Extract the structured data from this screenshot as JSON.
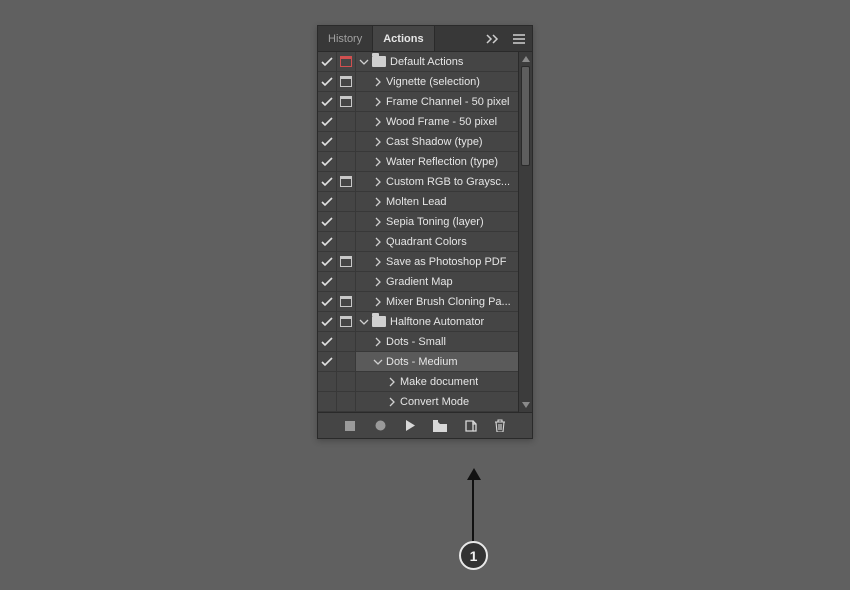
{
  "tabs": {
    "history": "History",
    "actions": "Actions",
    "active": "actions"
  },
  "list": [
    {
      "check": true,
      "dlg": "red",
      "depth": 0,
      "kind": "folder-open",
      "label": "Default Actions"
    },
    {
      "check": true,
      "dlg": "on",
      "depth": 1,
      "kind": "action-closed",
      "label": "Vignette (selection)"
    },
    {
      "check": true,
      "dlg": "on",
      "depth": 1,
      "kind": "action-closed",
      "label": "Frame Channel - 50 pixel"
    },
    {
      "check": true,
      "dlg": "off",
      "depth": 1,
      "kind": "action-closed",
      "label": "Wood Frame - 50 pixel"
    },
    {
      "check": true,
      "dlg": "off",
      "depth": 1,
      "kind": "action-closed",
      "label": "Cast Shadow (type)"
    },
    {
      "check": true,
      "dlg": "off",
      "depth": 1,
      "kind": "action-closed",
      "label": "Water Reflection (type)"
    },
    {
      "check": true,
      "dlg": "on",
      "depth": 1,
      "kind": "action-closed",
      "label": "Custom RGB to Graysc..."
    },
    {
      "check": true,
      "dlg": "off",
      "depth": 1,
      "kind": "action-closed",
      "label": "Molten Lead"
    },
    {
      "check": true,
      "dlg": "off",
      "depth": 1,
      "kind": "action-closed",
      "label": "Sepia Toning (layer)"
    },
    {
      "check": true,
      "dlg": "off",
      "depth": 1,
      "kind": "action-closed",
      "label": "Quadrant Colors"
    },
    {
      "check": true,
      "dlg": "on",
      "depth": 1,
      "kind": "action-closed",
      "label": "Save as Photoshop PDF"
    },
    {
      "check": true,
      "dlg": "off",
      "depth": 1,
      "kind": "action-closed",
      "label": "Gradient Map"
    },
    {
      "check": true,
      "dlg": "on",
      "depth": 1,
      "kind": "action-closed",
      "label": "Mixer Brush Cloning Pa..."
    },
    {
      "check": true,
      "dlg": "on",
      "depth": 0,
      "kind": "folder-open",
      "label": "Halftone Automator"
    },
    {
      "check": true,
      "dlg": "off",
      "depth": 1,
      "kind": "action-closed",
      "label": "Dots - Small"
    },
    {
      "check": true,
      "dlg": "off",
      "depth": 1,
      "kind": "action-open",
      "label": "Dots - Medium",
      "selected": true
    },
    {
      "check": false,
      "dlg": "off",
      "depth": 2,
      "kind": "step-closed",
      "label": "Make document"
    },
    {
      "check": false,
      "dlg": "off",
      "depth": 2,
      "kind": "step-closed",
      "label": "Convert Mode"
    }
  ],
  "footer": {
    "stop": "stop",
    "record": "record",
    "play": "play",
    "newSet": "new-set",
    "newAction": "new-action",
    "trash": "trash"
  },
  "annotation": {
    "number": "1"
  }
}
